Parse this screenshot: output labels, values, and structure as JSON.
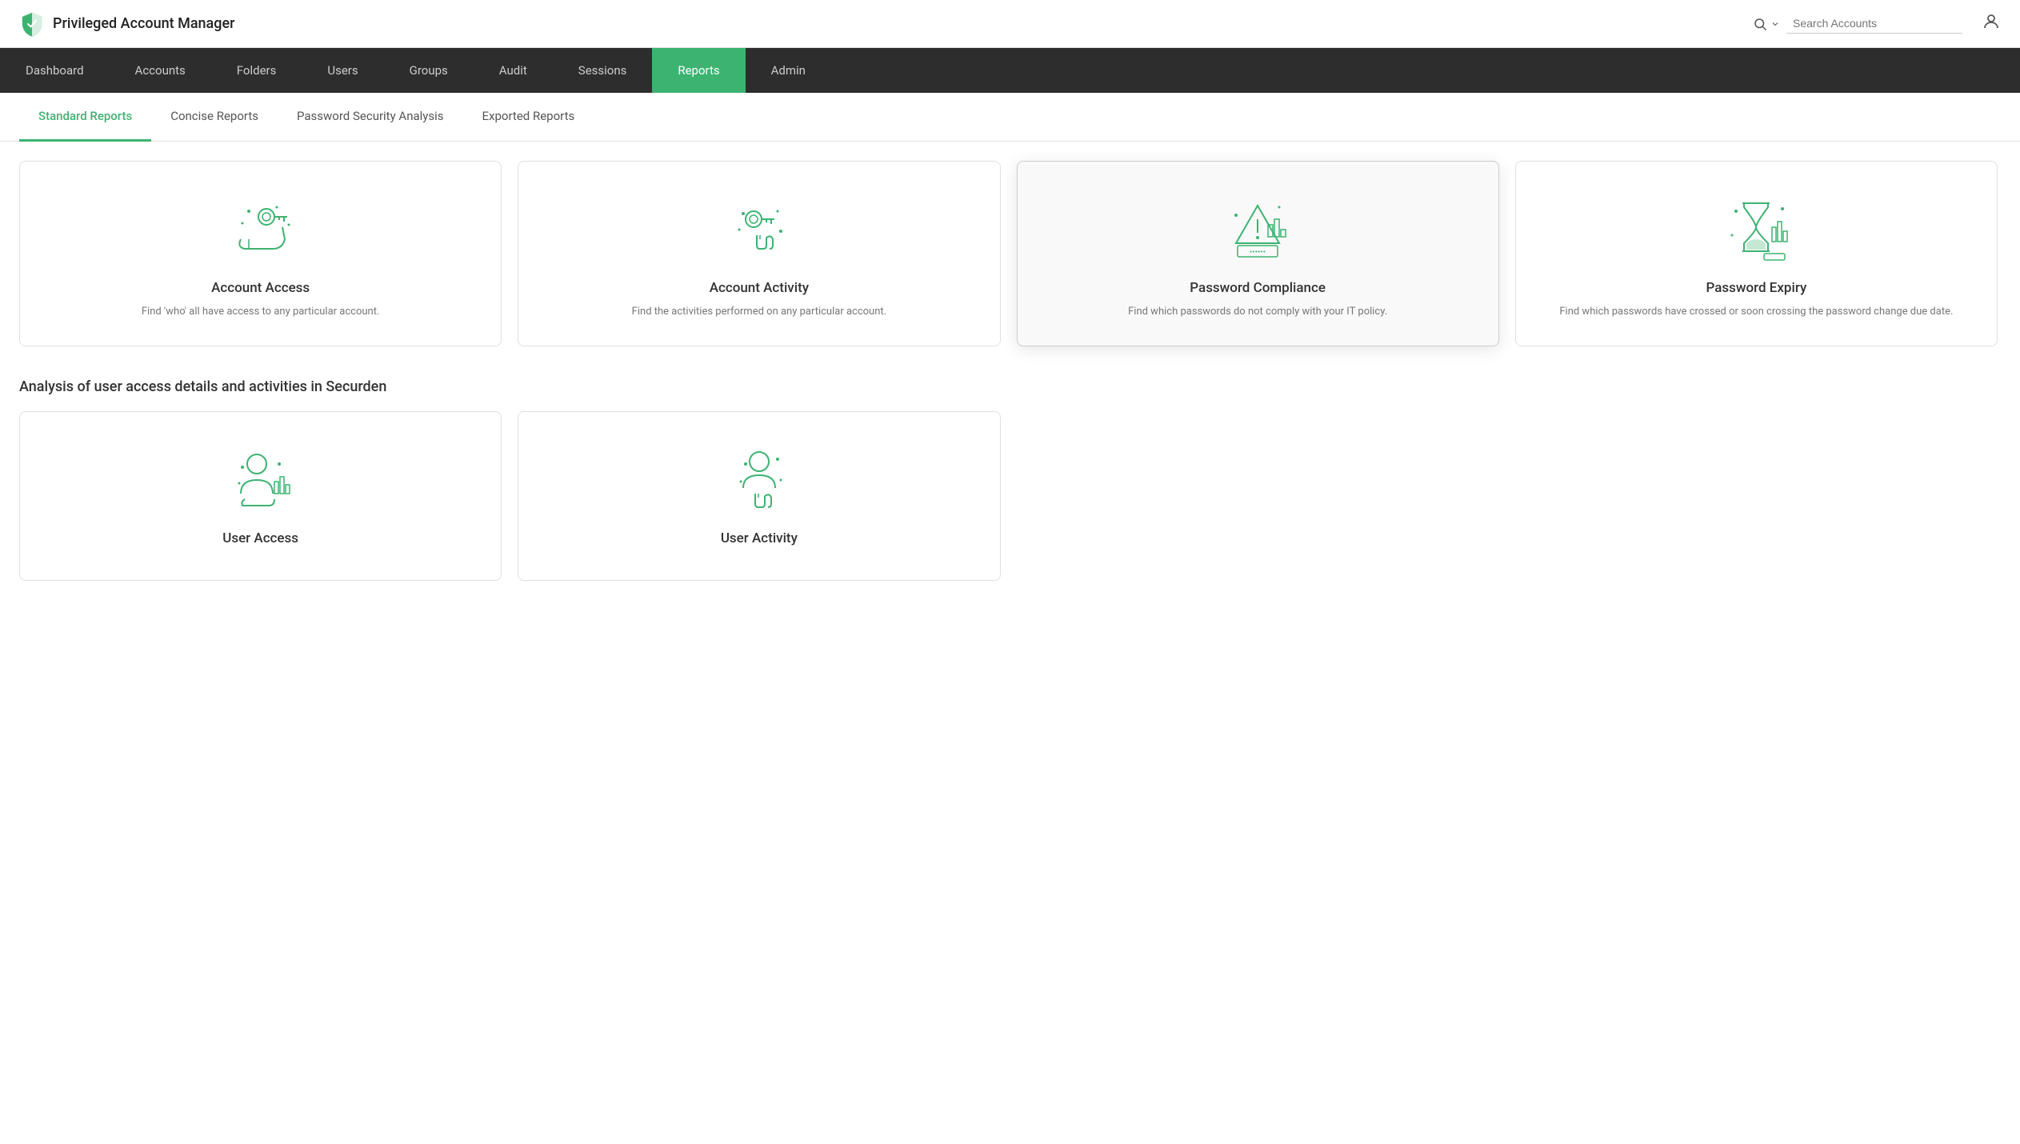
{
  "app": {
    "title": "Privileged Account Manager",
    "logo_alt": "PAM Logo"
  },
  "search": {
    "placeholder": "Search Accounts"
  },
  "nav": {
    "items": [
      {
        "id": "dashboard",
        "label": "Dashboard",
        "active": false
      },
      {
        "id": "accounts",
        "label": "Accounts",
        "active": false
      },
      {
        "id": "folders",
        "label": "Folders",
        "active": false
      },
      {
        "id": "users",
        "label": "Users",
        "active": false
      },
      {
        "id": "groups",
        "label": "Groups",
        "active": false
      },
      {
        "id": "audit",
        "label": "Audit",
        "active": false
      },
      {
        "id": "sessions",
        "label": "Sessions",
        "active": false
      },
      {
        "id": "reports",
        "label": "Reports",
        "active": true
      },
      {
        "id": "admin",
        "label": "Admin",
        "active": false
      }
    ]
  },
  "tabs": [
    {
      "id": "standard",
      "label": "Standard Reports",
      "active": true
    },
    {
      "id": "concise",
      "label": "Concise Reports",
      "active": false
    },
    {
      "id": "password",
      "label": "Password Security Analysis",
      "active": false
    },
    {
      "id": "exported",
      "label": "Exported Reports",
      "active": false
    }
  ],
  "section1": {
    "cards": [
      {
        "id": "account-access",
        "title": "Account Access",
        "desc": "Find 'who' all have access to any particular account.",
        "selected": false
      },
      {
        "id": "account-activity",
        "title": "Account Activity",
        "desc": "Find the activities performed on any particular account.",
        "selected": false
      },
      {
        "id": "password-compliance",
        "title": "Password Compliance",
        "desc": "Find which passwords do not comply with your IT policy.",
        "selected": true
      },
      {
        "id": "password-expiry",
        "title": "Password Expiry",
        "desc": "Find which passwords have crossed or soon crossing the password change due date.",
        "selected": false
      }
    ]
  },
  "section2": {
    "heading": "Analysis of user access details and activities in Securden",
    "cards": [
      {
        "id": "user-access",
        "title": "User Access",
        "desc": "",
        "selected": false
      },
      {
        "id": "user-activity",
        "title": "User Activity",
        "desc": "",
        "selected": false
      }
    ]
  }
}
